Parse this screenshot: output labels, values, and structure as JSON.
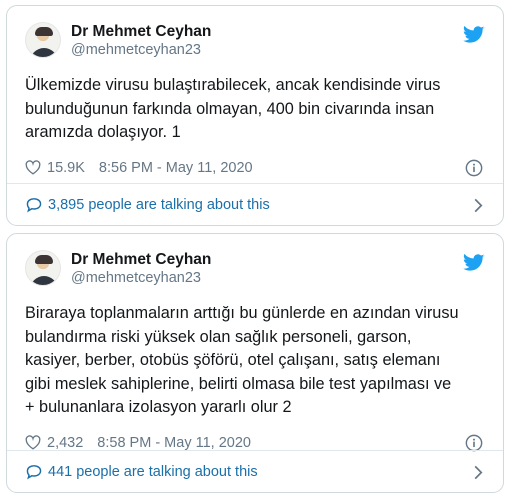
{
  "tweets": [
    {
      "author": "Dr Mehmet Ceyhan",
      "handle": "@mehmetceyhan23",
      "text": "Ülkemizde virusu bulaştırabilecek, ancak kendisinde virus bulunduğunun farkında olmayan, 400 bin civarında insan aramızda dolaşıyor. 1",
      "likes": "15.9K",
      "timestamp": "8:56 PM - May 11, 2020",
      "talking": "3,895 people are talking about this"
    },
    {
      "author": "Dr Mehmet Ceyhan",
      "handle": "@mehmetceyhan23",
      "text": "Biraraya toplanmaların arttığı bu günlerde en azından virusu bulandırma riski yüksek olan sağlık personeli, garson, kasiyer, berber, otobüs şöförü, otel çalışanı, satış elemanı gibi meslek sahiplerine, belirti olmasa bile test yapılması ve + bulunanlara izolasyon yararlı olur 2",
      "likes": "2,432",
      "timestamp": "8:58 PM - May 11, 2020",
      "talking": "441 people are talking about this"
    }
  ],
  "icons": {
    "brand": "twitter-bird-icon",
    "like": "heart-icon",
    "info": "info-icon",
    "talking": "speech-bubble-icon",
    "open": "chevron-right-icon"
  },
  "colors": {
    "twitter_blue": "#1da1f2",
    "link_blue": "#1b6fa8",
    "muted_gray": "#657786",
    "text": "#14171a",
    "border": "#cfd9de"
  }
}
